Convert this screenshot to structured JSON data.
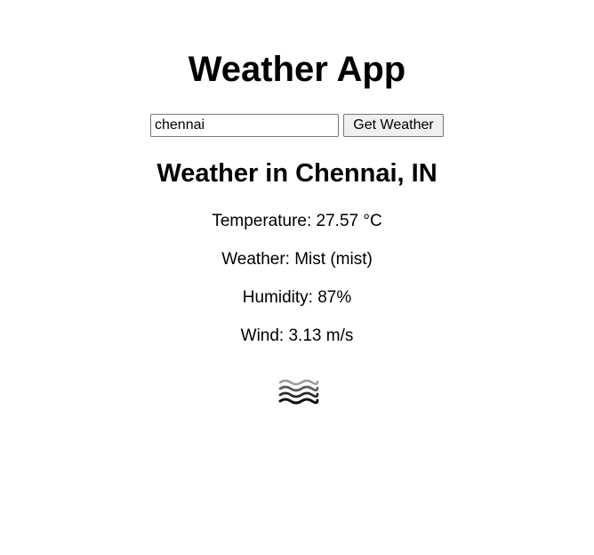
{
  "app": {
    "title": "Weather App"
  },
  "search": {
    "value": "chennai",
    "button_label": "Get Weather"
  },
  "result": {
    "heading": "Weather in Chennai, IN",
    "temperature": "Temperature: 27.57 °C",
    "weather": "Weather: Mist (mist)",
    "humidity": "Humidity: 87%",
    "wind": "Wind: 3.13 m/s",
    "icon": "mist-icon"
  }
}
